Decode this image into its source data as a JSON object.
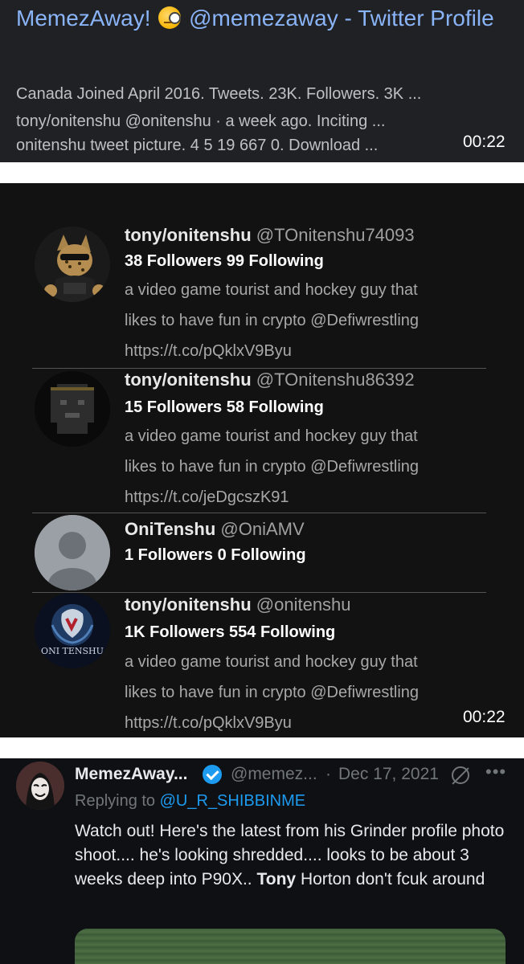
{
  "search_result": {
    "title_prefix": "MemezAway!",
    "title_emoji": "face-with-monocle-emoji",
    "title_suffix": "@memezaway - Twitter Profile",
    "snippet_lines": [
      "Canada Joined April 2016. Tweets. 23K. Followers. 3K ...",
      "tony/onitenshu @onitenshu · a week ago. Inciting ...",
      "onitenshu tweet picture. 4 5 19 667 0. Download ..."
    ],
    "duration": "00:22"
  },
  "video": {
    "duration": "00:22",
    "profiles": [
      {
        "name": "tony/onitenshu",
        "handle": "@TOnitenshu74093",
        "stats": "38 Followers 99 Following",
        "bio": [
          "a video game tourist and hockey guy that",
          "likes to have fun in crypto @Defiwrestling",
          "https://t.co/pQklxV9Byu"
        ]
      },
      {
        "name": "tony/onitenshu",
        "handle": "@TOnitenshu86392",
        "stats": "15 Followers 58 Following",
        "bio": [
          "a video game tourist and hockey guy that",
          "likes to have fun in crypto @Defiwrestling",
          "https://t.co/jeDgcszK91"
        ]
      },
      {
        "name": "OniTenshu",
        "handle": "@OniAMV",
        "stats": "1 Followers 0 Following",
        "bio": []
      },
      {
        "name": "tony/onitenshu",
        "handle": "@onitenshu",
        "stats": "1K Followers 554 Following",
        "avatar_text": "ONI TENSHU",
        "bio": [
          "a video game tourist and hockey guy that",
          "likes to have fun in crypto @Defiwrestling",
          "https://t.co/pQklxV9Byu"
        ]
      }
    ]
  },
  "tweet": {
    "name": "MemezAway...",
    "handle": "@memez...",
    "separator": "·",
    "date": "Dec 17, 2021",
    "replying_label": "Replying to",
    "replying_to": "@U_R_SHIBBINME",
    "text_before_bold": "Watch out! Here's the latest from his Grinder profile photo shoot.... he's looking shredded.... looks to be about 3 weeks deep into P90X..",
    "text_bold": "Tony",
    "text_after_bold": "Horton don't fcuk around",
    "more_glyph": "•••"
  },
  "colors": {
    "link_blue": "#8ab4f8",
    "twitter_blue": "#1d9bf0",
    "card_bg": "#202124",
    "video_bg": "#121212"
  }
}
